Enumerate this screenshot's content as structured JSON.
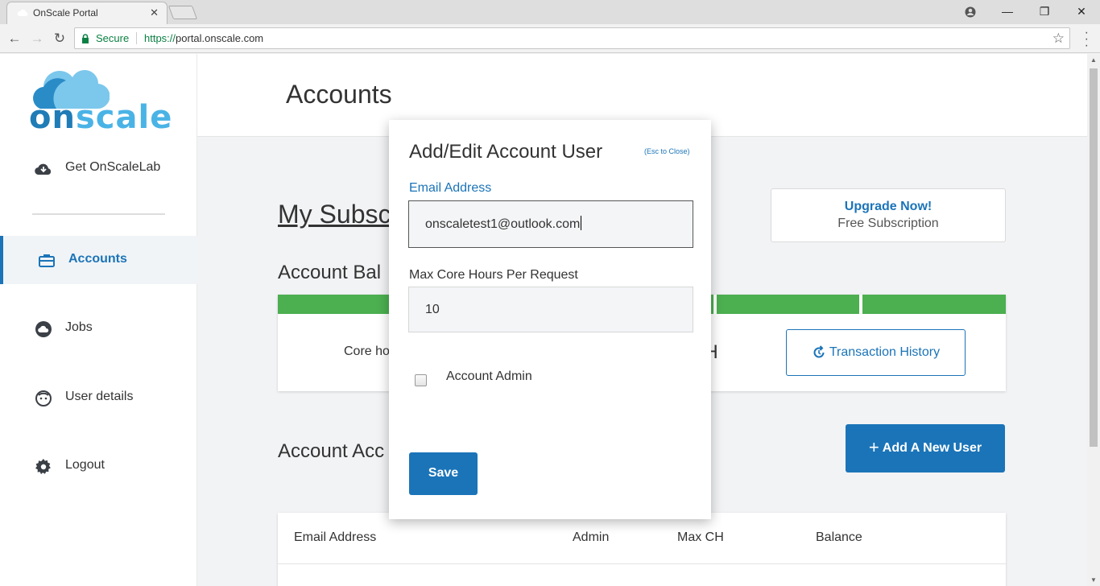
{
  "browser": {
    "tab_title": "OnScale Portal",
    "tab_close": "✕",
    "secure_label": "Secure",
    "url_scheme": "https://",
    "url_host": "portal.onscale.com"
  },
  "sidebar": {
    "logo_on": "on",
    "logo_scale": "scale",
    "items": [
      {
        "label": "Get OnScaleLab",
        "icon": "cloud-download-icon"
      },
      {
        "label": "Accounts",
        "icon": "briefcase-icon",
        "active": true
      },
      {
        "label": "Jobs",
        "icon": "cloud-icon"
      },
      {
        "label": "User details",
        "icon": "user-face-icon"
      },
      {
        "label": "Logout",
        "icon": "gear-icon"
      }
    ]
  },
  "main": {
    "page_title": "Accounts",
    "subscription_title": "My Subsc",
    "upgrade": {
      "cta": "Upgrade Now!",
      "plan": "Free Subscription"
    },
    "balance_title": "Account Bal",
    "core_hours_label": "Core ho",
    "ch_text": "CH",
    "transaction_history": "Transaction History",
    "accounts_title": "Account Acc",
    "add_user_button": "Add A New User",
    "table_headers": [
      "Email Address",
      "Admin",
      "Max CH",
      "Balance"
    ]
  },
  "modal": {
    "title": "Add/Edit Account User",
    "esc_hint": "(Esc to Close)",
    "email_label": "Email Address",
    "email_value": "onscaletest1@outlook.com",
    "core_label": "Max Core Hours Per Request",
    "core_value": "10",
    "admin_label": "Account Admin",
    "admin_checked": false,
    "save_button": "Save"
  },
  "colors": {
    "primary": "#1b74b8",
    "green": "#4caf50",
    "logo_dark": "#1f7cb6",
    "logo_light": "#4ab3e6"
  }
}
